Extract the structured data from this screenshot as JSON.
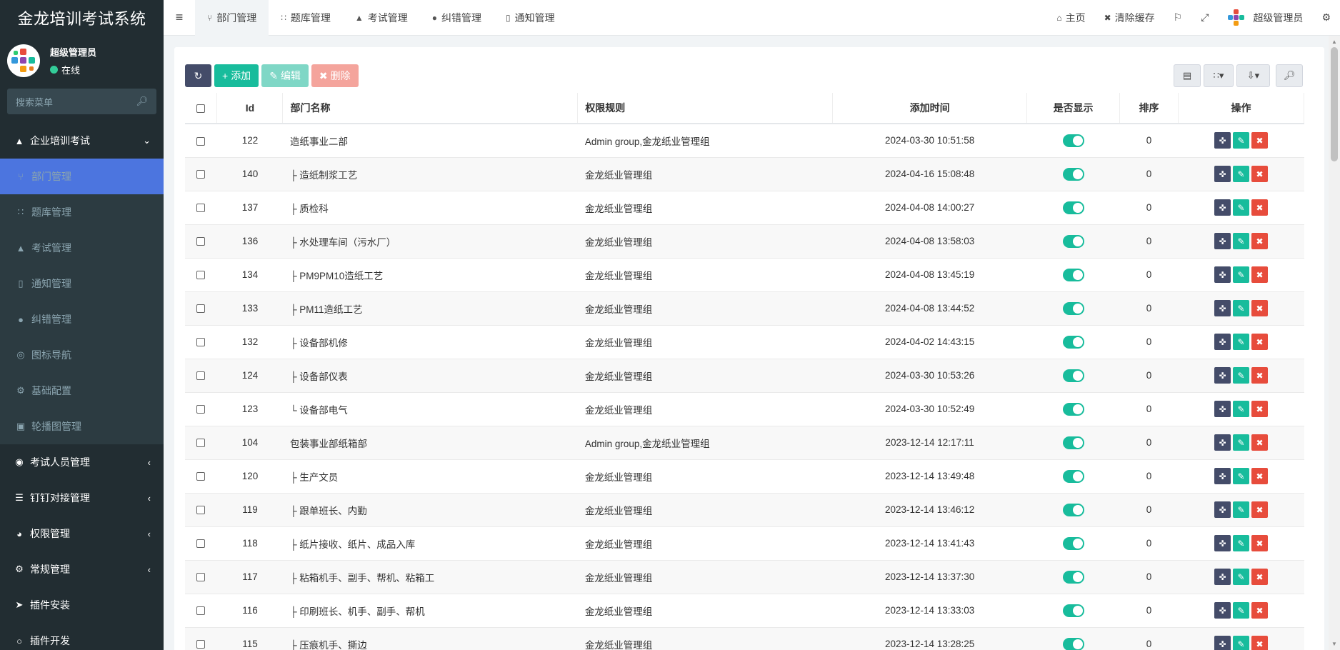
{
  "app": {
    "title": "金龙培训考试系统"
  },
  "user": {
    "name": "超级管理员",
    "status": "在线"
  },
  "search": {
    "placeholder": "搜索菜单"
  },
  "sidebar": {
    "section": {
      "label": "企业培训考试",
      "icon": "graduation-cap-icon"
    },
    "submenu": [
      {
        "label": "部门管理",
        "icon": "sitemap-icon",
        "active": true
      },
      {
        "label": "题库管理",
        "icon": "grid-icon"
      },
      {
        "label": "考试管理",
        "icon": "graduation-cap-icon"
      },
      {
        "label": "通知管理",
        "icon": "file-icon"
      },
      {
        "label": "纠错管理",
        "icon": "exclamation-icon"
      },
      {
        "label": "图标导航",
        "icon": "compass-icon"
      },
      {
        "label": "基础配置",
        "icon": "gear-icon"
      },
      {
        "label": "轮播图管理",
        "icon": "image-icon"
      }
    ],
    "items": [
      {
        "label": "考试人员管理",
        "icon": "user-circle-icon"
      },
      {
        "label": "钉钉对接管理",
        "icon": "list-icon"
      },
      {
        "label": "权限管理",
        "icon": "users-icon"
      },
      {
        "label": "常规管理",
        "icon": "cogs-icon"
      },
      {
        "label": "插件安装",
        "icon": "rocket-icon"
      },
      {
        "label": "插件开发",
        "icon": "circle-icon"
      }
    ]
  },
  "tabs": [
    {
      "label": "部门管理",
      "icon": "sitemap-icon",
      "active": true
    },
    {
      "label": "题库管理",
      "icon": "grid-icon"
    },
    {
      "label": "考试管理",
      "icon": "graduation-cap-icon"
    },
    {
      "label": "纠错管理",
      "icon": "exclamation-icon"
    },
    {
      "label": "通知管理",
      "icon": "file-icon"
    }
  ],
  "topright": {
    "home": "主页",
    "clear_cache": "清除缓存",
    "admin": "超级管理员"
  },
  "toolbar": {
    "add": "添加",
    "edit": "编辑",
    "delete": "删除"
  },
  "table": {
    "headers": [
      "Id",
      "部门名称",
      "权限规则",
      "添加时间",
      "是否显示",
      "排序",
      "操作"
    ],
    "rows": [
      {
        "id": "122",
        "name": "造纸事业二部",
        "rule": "Admin group,金龙纸业管理组",
        "time": "2024-03-30 10:51:58",
        "sort": "0"
      },
      {
        "id": "140",
        "name": "├ 造纸制浆工艺",
        "rule": "金龙纸业管理组",
        "time": "2024-04-16 15:08:48",
        "sort": "0"
      },
      {
        "id": "137",
        "name": "├ 质检科",
        "rule": "金龙纸业管理组",
        "time": "2024-04-08 14:00:27",
        "sort": "0"
      },
      {
        "id": "136",
        "name": "├ 水处理车间（污水厂）",
        "rule": "金龙纸业管理组",
        "time": "2024-04-08 13:58:03",
        "sort": "0"
      },
      {
        "id": "134",
        "name": "├ PM9PM10造纸工艺",
        "rule": "金龙纸业管理组",
        "time": "2024-04-08 13:45:19",
        "sort": "0"
      },
      {
        "id": "133",
        "name": "├ PM11造纸工艺",
        "rule": "金龙纸业管理组",
        "time": "2024-04-08 13:44:52",
        "sort": "0"
      },
      {
        "id": "132",
        "name": "├ 设备部机修",
        "rule": "金龙纸业管理组",
        "time": "2024-04-02 14:43:15",
        "sort": "0"
      },
      {
        "id": "124",
        "name": "├ 设备部仪表",
        "rule": "金龙纸业管理组",
        "time": "2024-03-30 10:53:26",
        "sort": "0"
      },
      {
        "id": "123",
        "name": "└ 设备部电气",
        "rule": "金龙纸业管理组",
        "time": "2024-03-30 10:52:49",
        "sort": "0"
      },
      {
        "id": "104",
        "name": "包装事业部纸箱部",
        "rule": "Admin group,金龙纸业管理组",
        "time": "2023-12-14 12:17:11",
        "sort": "0"
      },
      {
        "id": "120",
        "name": "├ 生产文员",
        "rule": "金龙纸业管理组",
        "time": "2023-12-14 13:49:48",
        "sort": "0"
      },
      {
        "id": "119",
        "name": "├ 跟单班长、内勤",
        "rule": "金龙纸业管理组",
        "time": "2023-12-14 13:46:12",
        "sort": "0"
      },
      {
        "id": "118",
        "name": "├ 纸片接收、纸片、成品入库",
        "rule": "金龙纸业管理组",
        "time": "2023-12-14 13:41:43",
        "sort": "0"
      },
      {
        "id": "117",
        "name": "├ 粘箱机手、副手、帮机、粘箱工",
        "rule": "金龙纸业管理组",
        "time": "2023-12-14 13:37:30",
        "sort": "0"
      },
      {
        "id": "116",
        "name": "├ 印刷班长、机手、副手、帮机",
        "rule": "金龙纸业管理组",
        "time": "2023-12-14 13:33:03",
        "sort": "0"
      },
      {
        "id": "115",
        "name": "├ 压痕机手、撕边",
        "rule": "金龙纸业管理组",
        "time": "2023-12-14 13:28:25",
        "sort": "0"
      }
    ]
  },
  "colors": {
    "sidebar_bg": "#222d32",
    "active": "#4c75df",
    "green": "#18bc9c",
    "red": "#e74c3c",
    "dark": "#444c69"
  }
}
